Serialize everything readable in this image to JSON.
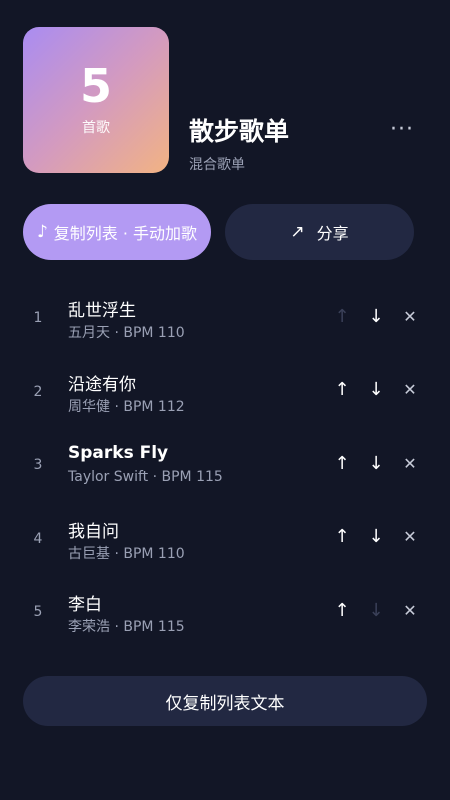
{
  "playlist": {
    "cover_count": "5",
    "cover_unit": "首歌",
    "title": "散步歌单",
    "subtitle": "混合歌单",
    "more_label": "···"
  },
  "actions": {
    "copy_label": "复制列表 · 手动加歌",
    "share_label": "分享",
    "copy_text_label": "仅复制列表文本"
  },
  "icons": {
    "note": "♪",
    "share": "↗",
    "up": "↑",
    "down": "↓",
    "remove": "✕"
  },
  "songs": [
    {
      "index": "1",
      "title": "乱世浮生",
      "meta": "五月天 · BPM 110",
      "up_enabled": false,
      "down_enabled": true
    },
    {
      "index": "2",
      "title": "沿途有你",
      "meta": "周华健 · BPM 112",
      "up_enabled": true,
      "down_enabled": true
    },
    {
      "index": "3",
      "title": "Sparks Fly",
      "meta": "Taylor Swift · BPM 115",
      "up_enabled": true,
      "down_enabled": true
    },
    {
      "index": "4",
      "title": "我自问",
      "meta": "古巨基 · BPM 110",
      "up_enabled": true,
      "down_enabled": true
    },
    {
      "index": "5",
      "title": "李白",
      "meta": "李荣浩 · BPM 115",
      "up_enabled": true,
      "down_enabled": false
    }
  ],
  "colors": {
    "background": "#121626",
    "accent": "#b39af3",
    "secondary_button": "#222842",
    "muted_text": "#9aa0b4"
  }
}
